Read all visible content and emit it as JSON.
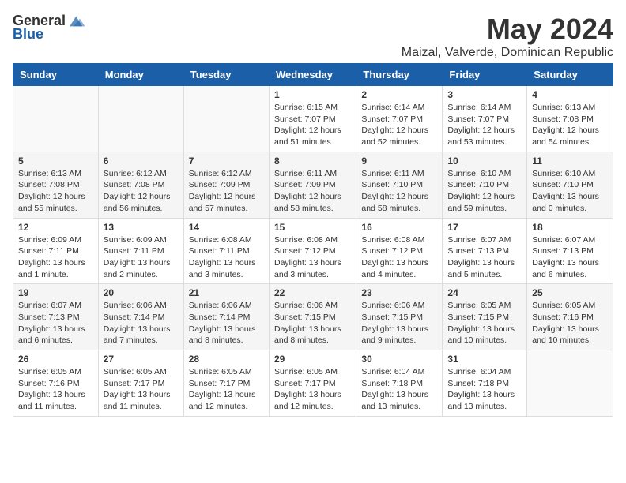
{
  "header": {
    "logo_general": "General",
    "logo_blue": "Blue",
    "title": "May 2024",
    "subtitle": "Maizal, Valverde, Dominican Republic"
  },
  "days_of_week": [
    "Sunday",
    "Monday",
    "Tuesday",
    "Wednesday",
    "Thursday",
    "Friday",
    "Saturday"
  ],
  "weeks": [
    [
      {
        "day": "",
        "info": ""
      },
      {
        "day": "",
        "info": ""
      },
      {
        "day": "",
        "info": ""
      },
      {
        "day": "1",
        "info": "Sunrise: 6:15 AM\nSunset: 7:07 PM\nDaylight: 12 hours\nand 51 minutes."
      },
      {
        "day": "2",
        "info": "Sunrise: 6:14 AM\nSunset: 7:07 PM\nDaylight: 12 hours\nand 52 minutes."
      },
      {
        "day": "3",
        "info": "Sunrise: 6:14 AM\nSunset: 7:07 PM\nDaylight: 12 hours\nand 53 minutes."
      },
      {
        "day": "4",
        "info": "Sunrise: 6:13 AM\nSunset: 7:08 PM\nDaylight: 12 hours\nand 54 minutes."
      }
    ],
    [
      {
        "day": "5",
        "info": "Sunrise: 6:13 AM\nSunset: 7:08 PM\nDaylight: 12 hours\nand 55 minutes."
      },
      {
        "day": "6",
        "info": "Sunrise: 6:12 AM\nSunset: 7:08 PM\nDaylight: 12 hours\nand 56 minutes."
      },
      {
        "day": "7",
        "info": "Sunrise: 6:12 AM\nSunset: 7:09 PM\nDaylight: 12 hours\nand 57 minutes."
      },
      {
        "day": "8",
        "info": "Sunrise: 6:11 AM\nSunset: 7:09 PM\nDaylight: 12 hours\nand 58 minutes."
      },
      {
        "day": "9",
        "info": "Sunrise: 6:11 AM\nSunset: 7:10 PM\nDaylight: 12 hours\nand 58 minutes."
      },
      {
        "day": "10",
        "info": "Sunrise: 6:10 AM\nSunset: 7:10 PM\nDaylight: 12 hours\nand 59 minutes."
      },
      {
        "day": "11",
        "info": "Sunrise: 6:10 AM\nSunset: 7:10 PM\nDaylight: 13 hours\nand 0 minutes."
      }
    ],
    [
      {
        "day": "12",
        "info": "Sunrise: 6:09 AM\nSunset: 7:11 PM\nDaylight: 13 hours\nand 1 minute."
      },
      {
        "day": "13",
        "info": "Sunrise: 6:09 AM\nSunset: 7:11 PM\nDaylight: 13 hours\nand 2 minutes."
      },
      {
        "day": "14",
        "info": "Sunrise: 6:08 AM\nSunset: 7:11 PM\nDaylight: 13 hours\nand 3 minutes."
      },
      {
        "day": "15",
        "info": "Sunrise: 6:08 AM\nSunset: 7:12 PM\nDaylight: 13 hours\nand 3 minutes."
      },
      {
        "day": "16",
        "info": "Sunrise: 6:08 AM\nSunset: 7:12 PM\nDaylight: 13 hours\nand 4 minutes."
      },
      {
        "day": "17",
        "info": "Sunrise: 6:07 AM\nSunset: 7:13 PM\nDaylight: 13 hours\nand 5 minutes."
      },
      {
        "day": "18",
        "info": "Sunrise: 6:07 AM\nSunset: 7:13 PM\nDaylight: 13 hours\nand 6 minutes."
      }
    ],
    [
      {
        "day": "19",
        "info": "Sunrise: 6:07 AM\nSunset: 7:13 PM\nDaylight: 13 hours\nand 6 minutes."
      },
      {
        "day": "20",
        "info": "Sunrise: 6:06 AM\nSunset: 7:14 PM\nDaylight: 13 hours\nand 7 minutes."
      },
      {
        "day": "21",
        "info": "Sunrise: 6:06 AM\nSunset: 7:14 PM\nDaylight: 13 hours\nand 8 minutes."
      },
      {
        "day": "22",
        "info": "Sunrise: 6:06 AM\nSunset: 7:15 PM\nDaylight: 13 hours\nand 8 minutes."
      },
      {
        "day": "23",
        "info": "Sunrise: 6:06 AM\nSunset: 7:15 PM\nDaylight: 13 hours\nand 9 minutes."
      },
      {
        "day": "24",
        "info": "Sunrise: 6:05 AM\nSunset: 7:15 PM\nDaylight: 13 hours\nand 10 minutes."
      },
      {
        "day": "25",
        "info": "Sunrise: 6:05 AM\nSunset: 7:16 PM\nDaylight: 13 hours\nand 10 minutes."
      }
    ],
    [
      {
        "day": "26",
        "info": "Sunrise: 6:05 AM\nSunset: 7:16 PM\nDaylight: 13 hours\nand 11 minutes."
      },
      {
        "day": "27",
        "info": "Sunrise: 6:05 AM\nSunset: 7:17 PM\nDaylight: 13 hours\nand 11 minutes."
      },
      {
        "day": "28",
        "info": "Sunrise: 6:05 AM\nSunset: 7:17 PM\nDaylight: 13 hours\nand 12 minutes."
      },
      {
        "day": "29",
        "info": "Sunrise: 6:05 AM\nSunset: 7:17 PM\nDaylight: 13 hours\nand 12 minutes."
      },
      {
        "day": "30",
        "info": "Sunrise: 6:04 AM\nSunset: 7:18 PM\nDaylight: 13 hours\nand 13 minutes."
      },
      {
        "day": "31",
        "info": "Sunrise: 6:04 AM\nSunset: 7:18 PM\nDaylight: 13 hours\nand 13 minutes."
      },
      {
        "day": "",
        "info": ""
      }
    ]
  ]
}
